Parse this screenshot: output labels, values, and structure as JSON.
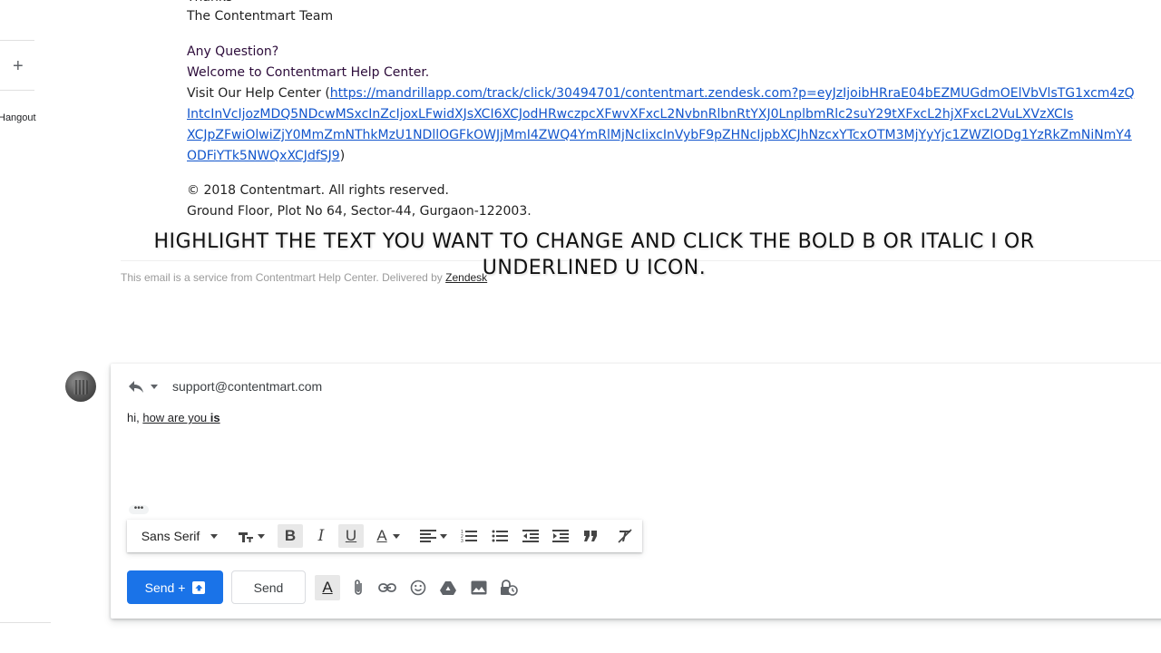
{
  "email": {
    "partial_top": "Thanks",
    "team_sig": "The Contentmart Team",
    "question": "Any Question?",
    "welcome": "Welcome to Contentmart Help Center.",
    "visit_label": "Visit Our Help Center (",
    "link_line1": "https://mandrillapp.com/track/click/30494701/contentmart.zendesk.com?p=eyJzIjoibHRraE04bEZMUGdmOElVbVlsTG1xcm4zQ",
    "link_line2": "IntcInVcIjozMDQ5NDcwMSxcInZcIjoxLFwidXJsXCI6XCJodHRwczpcXFwvXFxcL2NvbnRlbnRtYXJ0LnplbmRlc2suY29tXFxcL2hjXFxcL2VuLXVzXCIs",
    "link_line3": "XCJpZFwiOlwiZjY0MmZmNThkMzU1NDllOGFkOWJjMmI4ZWQ4YmRlMjNcIixcInVybF9pZHNcIjpbXCJhNzcxYTcxOTM3MjYyYjc1ZWZlODg1YzRkZmNiNmY4",
    "link_line4": "ODFiYTk5NWQxXCJdfSJ9",
    "link_close": ")",
    "copyright": "© 2018 Contentmart. All rights reserved.",
    "address": "Ground Floor, Plot No 64, Sector-44, Gurgaon-122003.",
    "footer_prefix": "This email is a service from Contentmart Help Center. Delivered by ",
    "footer_link": "Zendesk"
  },
  "caption": "HIGHLIGHT THE TEXT YOU WANT TO CHANGE AND CLICK THE BOLD B OR ITALIC I OR UNDERLINED U ICON.",
  "left_rail": {
    "hangouts_label": "Hangout"
  },
  "compose": {
    "recipient": "support@contentmart.com",
    "body_prefix": "hi, ",
    "body_underlined": "how are you ",
    "body_bold_underlined": " is ",
    "more_label": "•••"
  },
  "format_bar": {
    "font": "Sans Serif",
    "bold": "B",
    "italic": "I",
    "underline": "U",
    "text_color": "A"
  },
  "send_row": {
    "send_plus_label": "Send +",
    "send_label": "Send"
  },
  "colors": {
    "send_blue": "#1a73e8",
    "link_blue": "#1155cc"
  }
}
